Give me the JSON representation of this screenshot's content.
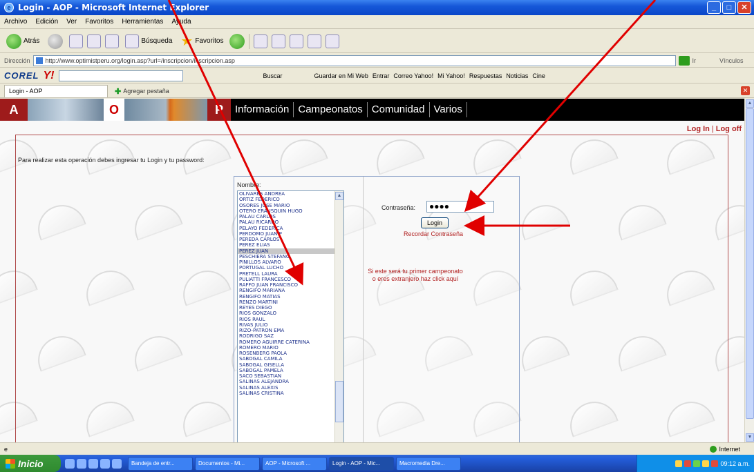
{
  "window": {
    "title": "Login - AOP - Microsoft Internet Explorer"
  },
  "menu": [
    "Archivo",
    "Edición",
    "Ver",
    "Favoritos",
    "Herramientas",
    "Ayuda"
  ],
  "toolbar": {
    "back": "Atrás",
    "search": "Búsqueda",
    "favorites": "Favoritos"
  },
  "address": {
    "label": "Dirección",
    "url": "http://www.optimistperu.org/login.asp?url=/inscripcion/inscripcion.asp",
    "go": "Ir",
    "links": "Vínculos"
  },
  "yahoo": {
    "corel": "COREL",
    "search_btn": "Buscar",
    "save": "Guardar en Mi Web",
    "enter": "Entrar",
    "mail": "Correo Yahoo!",
    "my_yahoo": "Mi Yahoo!",
    "answers": "Respuestas",
    "news": "Noticias",
    "cine": "Cine"
  },
  "tabs": {
    "active": "Login - AOP",
    "new_tab": "Agregar pestaña"
  },
  "site": {
    "logo_a": "A",
    "logo_o": "O",
    "logo_p": "P",
    "nav": [
      "Información",
      "Campeonatos",
      "Comunidad",
      "Varios"
    ],
    "log_in": "Log In",
    "log_off": "Log off",
    "separator": "|",
    "message": "Para realizar esta operación debes ingresar tu Login y tu password:"
  },
  "login": {
    "name_label": "Nombre:",
    "names": [
      "OLIVARES ANDREA",
      "ORTIZ FEDERICO",
      "OSORES JOSE MARIO",
      "OTERO ERAUSQUIN HUGO",
      "PALAU CARLOS",
      "PALAU RICARDO",
      "PELAYO FEDERICA",
      "PERDOMO JUAN P",
      "PEREDA CARLOS",
      "PEREZ ELIAS",
      "PEREZ JUAN",
      "PESCHIERA STEFANO",
      "PINILLOS ALVARO",
      "PORTUGAL LUCHO",
      "PRETELL LAURA",
      "PULIATTI FRANCESCO",
      "RAFFO JUAN FRANCISCO",
      "RENGIFO MARIANA",
      "RENGIFO MATIAS",
      "RENZO MARTINI",
      "REYES DIEGO",
      "RIOS GONZALO",
      "RIOS RAUL",
      "RIVAS JULIO",
      "RIZO-PATRON EMA",
      "RODRIGO SAZ",
      "ROMERO AGUIRRE CATERINA",
      "ROMERO MARIO",
      "ROSENBERG PAOLA",
      "SABOGAL CAMILA",
      "SABOGAL GISELLA",
      "SABOGAL PAMELA",
      "SACO SEBASTIAN",
      "SALINAS ALEJANDRA",
      "SALINAS ALEXIS",
      "SALINAS CRISTINA"
    ],
    "selected_name": "PEREZ JUAN",
    "password_label": "Contraseña:",
    "password_value": "●●●●",
    "button": "Login",
    "recover": "Recordar Contraseña",
    "first_time": "Si este será tu primer campeonato o eres extranjero haz click aquí"
  },
  "status": {
    "zone": "Internet"
  },
  "taskbar": {
    "start": "Inicio",
    "buttons": [
      "Bandeja de entr...",
      "Documentos - Mi...",
      "AOP - Microsoft ...",
      "Login - AOP - Mic...",
      "Macromedia Dre..."
    ],
    "active_index": 3,
    "time": "09:12 a.m."
  },
  "colors": {
    "site_red": "#9e1b1b",
    "link_red": "#b22222",
    "list_text": "#1b2f8a",
    "annotation_arrow": "#e00000"
  }
}
